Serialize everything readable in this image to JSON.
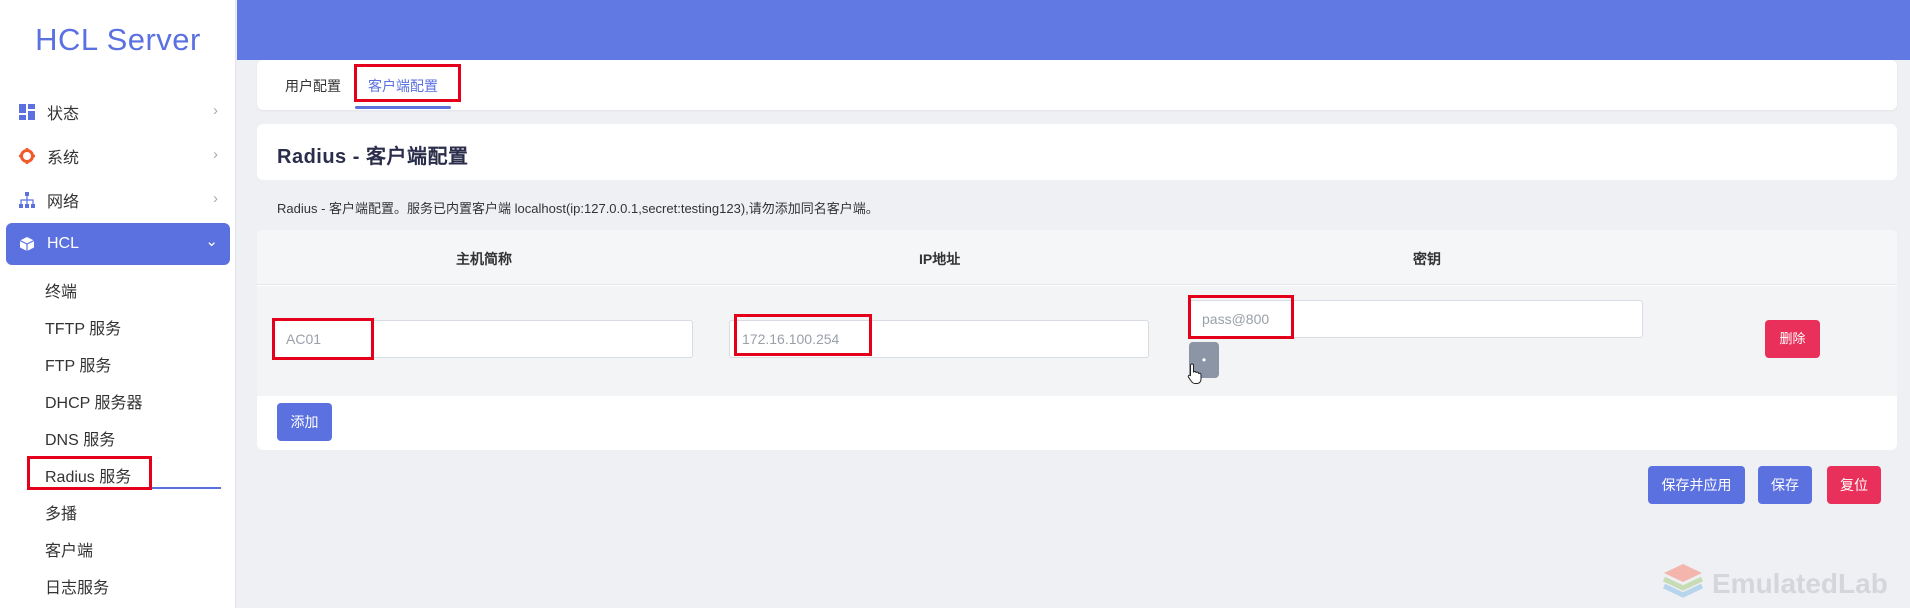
{
  "sidebar": {
    "brand": "HCL Server",
    "items": [
      {
        "label": "状态",
        "icon": "dashboard-icon"
      },
      {
        "label": "系统",
        "icon": "gear-icon"
      },
      {
        "label": "网络",
        "icon": "sitemap-icon"
      },
      {
        "label": "HCL",
        "icon": "cube-icon"
      }
    ],
    "sub_items": [
      "终端",
      "TFTP 服务",
      "FTP 服务",
      "DHCP 服务器",
      "DNS 服务",
      "Radius 服务",
      "多播",
      "客户端",
      "日志服务"
    ]
  },
  "tabs": [
    {
      "label": "用户配置"
    },
    {
      "label": "客户端配置"
    }
  ],
  "page_title": "Radius - 客户端配置",
  "description": "Radius - 客户端配置。服务已内置客户端 localhost(ip:127.0.0.1,secret:testing123),请勿添加同名客户端。",
  "table": {
    "headers": [
      "主机简称",
      "IP地址",
      "密钥"
    ],
    "rows": [
      {
        "host": "AC01",
        "ip": "172.16.100.254",
        "secret": "pass@800"
      }
    ]
  },
  "buttons": {
    "toggle": "•",
    "delete": "删除",
    "add": "添加",
    "save_apply": "保存并应用",
    "save": "保存",
    "reset": "复位"
  },
  "watermark": "EmulatedLab",
  "colors": {
    "accent": "#5b71e0",
    "header": "#6079e3",
    "danger": "#e8305a",
    "highlight": "#e4001b"
  }
}
